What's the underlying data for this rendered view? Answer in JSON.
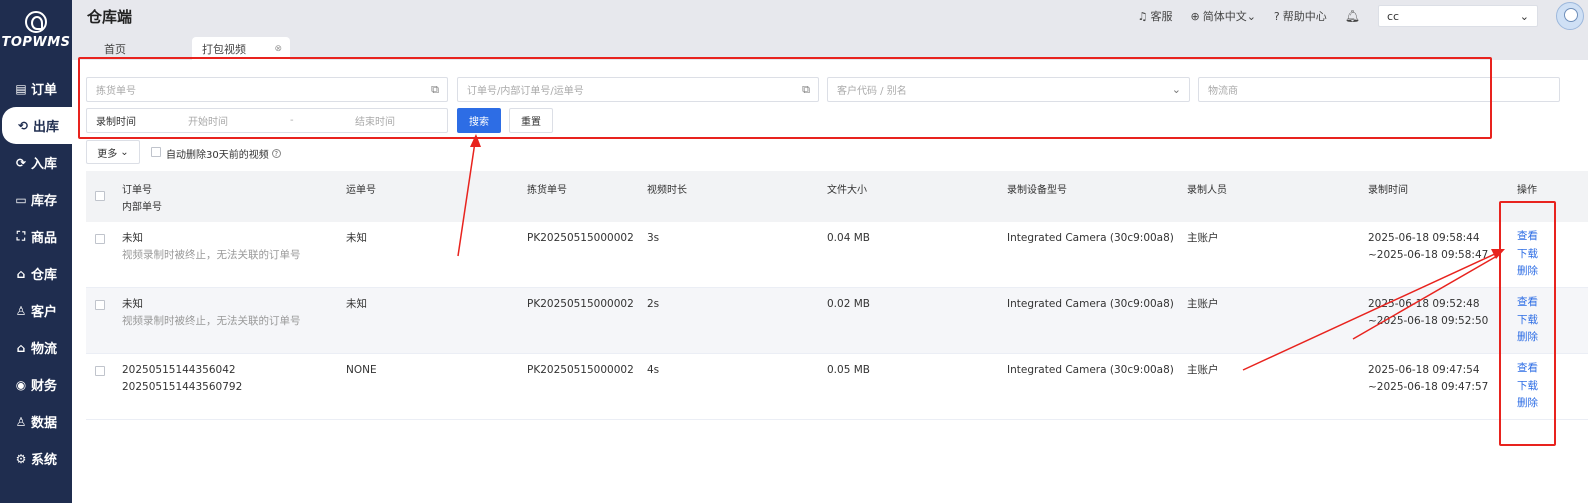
{
  "brand": {
    "logo_text": "TOPWMS"
  },
  "sidebar": {
    "items": [
      {
        "icon": "order-icon",
        "glyph": "▤",
        "label": "订单"
      },
      {
        "icon": "outbound-icon",
        "glyph": "⟲",
        "label": "出库"
      },
      {
        "icon": "inbound-icon",
        "glyph": "⟳",
        "label": "入库"
      },
      {
        "icon": "inventory-icon",
        "glyph": "▭",
        "label": "库存"
      },
      {
        "icon": "product-icon",
        "glyph": "⛶",
        "label": "商品"
      },
      {
        "icon": "warehouse-icon",
        "glyph": "⌂",
        "label": "仓库"
      },
      {
        "icon": "customer-icon",
        "glyph": "♙",
        "label": "客户"
      },
      {
        "icon": "logistics-icon",
        "glyph": "⌂",
        "label": "物流"
      },
      {
        "icon": "finance-icon",
        "glyph": "◉",
        "label": "财务"
      },
      {
        "icon": "data-icon",
        "glyph": "♙",
        "label": "数据"
      },
      {
        "icon": "system-icon",
        "glyph": "⚙",
        "label": "系统"
      }
    ]
  },
  "header": {
    "title": "仓库端",
    "service": "客服",
    "language": "简体中文",
    "help": "帮助中心",
    "user_value": "cc"
  },
  "tabs": {
    "home": "首页",
    "active": "打包视频"
  },
  "filters": {
    "pick_no_placeholder": "拣货单号",
    "order_no_placeholder": "订单号/内部订单号/运单号",
    "customer_placeholder": "客户代码 / 别名",
    "carrier_placeholder": "物流商",
    "record_time_label": "录制时间",
    "start_placeholder": "开始时间",
    "range_sep": "-",
    "end_placeholder": "结束时间",
    "search_button": "搜索",
    "reset_button": "重置",
    "more_button": "更多",
    "auto_delete_label": "自动删除30天前的视频"
  },
  "table": {
    "headers": {
      "order_no": "订单号",
      "internal_no": "内部单号",
      "waybill": "运单号",
      "pick_no": "拣货单号",
      "duration": "视频时长",
      "file_size": "文件大小",
      "device": "录制设备型号",
      "recorder": "录制人员",
      "record_time": "录制时间",
      "actions": "操作"
    },
    "rows": [
      {
        "order": "未知",
        "internal": "视频录制时被终止，无法关联的订单号",
        "waybill": "未知",
        "pick": "PK20250515000002",
        "duration": "3s",
        "size": "0.04 MB",
        "device": "Integrated Camera (30c9:00a8)",
        "recorder": "主账户",
        "time_start": "2025-06-18 09:58:44",
        "time_end": "~2025-06-18 09:58:47",
        "view": "查看",
        "download": "下载",
        "delete": "删除"
      },
      {
        "order": "未知",
        "internal": "视频录制时被终止，无法关联的订单号",
        "waybill": "未知",
        "pick": "PK20250515000002",
        "duration": "2s",
        "size": "0.02 MB",
        "device": "Integrated Camera (30c9:00a8)",
        "recorder": "主账户",
        "time_start": "2025-06-18 09:52:48",
        "time_end": "~2025-06-18 09:52:50",
        "view": "查看",
        "download": "下载",
        "delete": "删除"
      },
      {
        "order": "20250515144356042",
        "internal": "202505151443560792",
        "waybill": "NONE",
        "pick": "PK20250515000002",
        "duration": "4s",
        "size": "0.05 MB",
        "device": "Integrated Camera (30c9:00a8)",
        "recorder": "主账户",
        "time_start": "2025-06-18 09:47:54",
        "time_end": "~2025-06-18 09:47:57",
        "view": "查看",
        "download": "下载",
        "delete": "删除"
      }
    ]
  },
  "colors": {
    "sidebar_bg": "#1f2d4f",
    "primary": "#2d6de5",
    "annotation": "#e8231e"
  }
}
